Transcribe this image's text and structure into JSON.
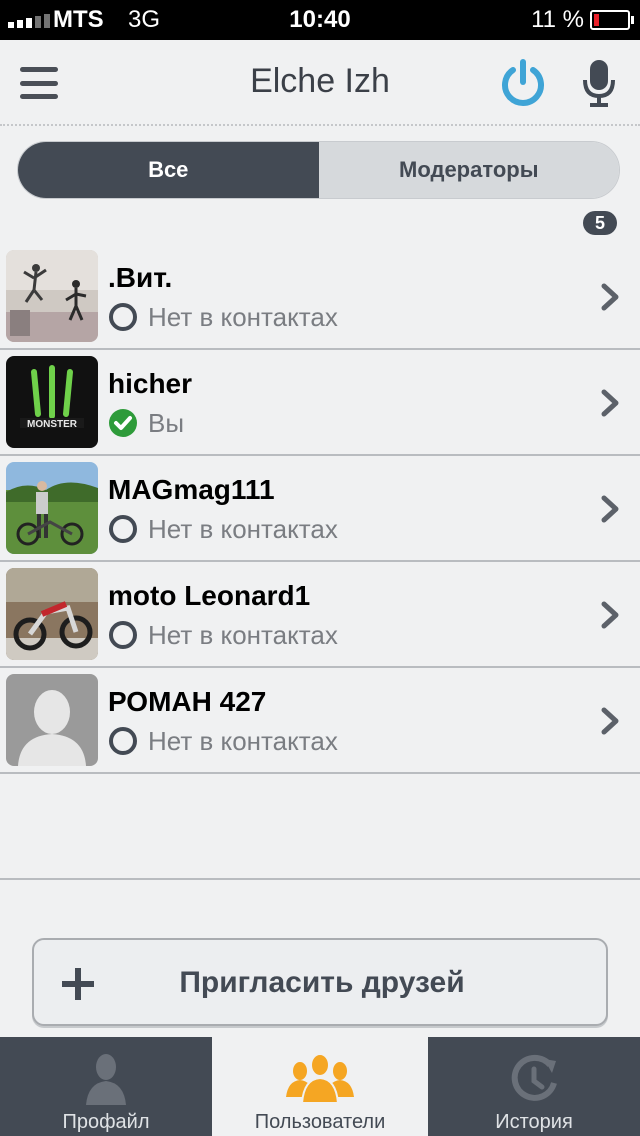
{
  "status_bar": {
    "carrier": "MTS",
    "network": "3G",
    "time": "10:40",
    "battery": "11 %",
    "battery_level": 0.11
  },
  "header": {
    "title": "Elche Izh",
    "menu_icon": "hamburger-menu-icon",
    "power_icon": "power-icon",
    "mic_icon": "microphone-icon",
    "accent_color": "#3fa4d6"
  },
  "segments": {
    "all": "Все",
    "moderators": "Модераторы"
  },
  "user_count": "5",
  "users": [
    {
      "name": ".Вит.",
      "status": "Нет в контактах",
      "status_icon": "circle-outline-icon"
    },
    {
      "name": "hicher",
      "status": "Вы",
      "status_icon": "check-circle-icon"
    },
    {
      "name": "MAGmag111",
      "status": "Нет в контактах",
      "status_icon": "circle-outline-icon"
    },
    {
      "name": "moto Leonard1",
      "status": "Нет в контактах",
      "status_icon": "circle-outline-icon"
    },
    {
      "name": "РОМАН 427",
      "status": "Нет в контактах",
      "status_icon": "circle-outline-icon"
    }
  ],
  "invite": {
    "label": "Пригласить друзей"
  },
  "tabs": [
    {
      "label": "Профайл",
      "icon": "person-icon"
    },
    {
      "label": "Пользователи",
      "icon": "users-group-icon"
    },
    {
      "label": "История",
      "icon": "history-clock-icon"
    }
  ],
  "colors": {
    "dark": "#434a54",
    "active_tab_icon": "#f5a623",
    "check_green": "#2e9b3a"
  }
}
